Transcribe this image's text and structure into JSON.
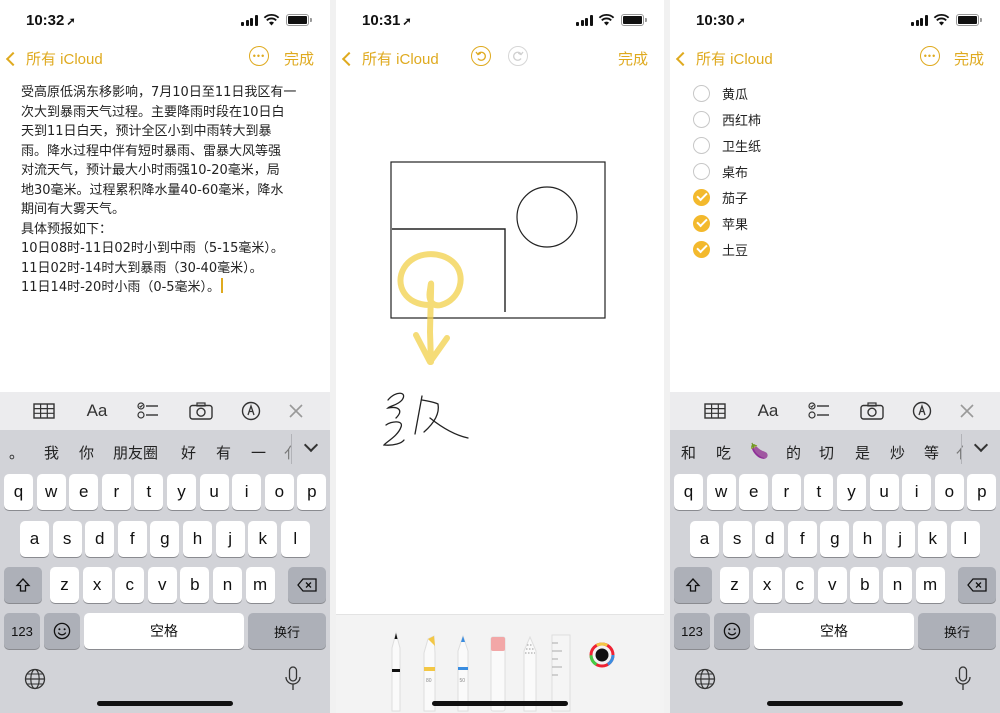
{
  "panels": [
    {
      "time": "10:32",
      "back_label": "所有 iCloud",
      "done_label": "完成",
      "note_lines": [
        "受高原低涡东移影响，7月10日至11日我区有一",
        "次大到暴雨天气过程。主要降雨时段在10日白",
        "天到11日白天，预计全区小到中雨转大到暴",
        "雨。降水过程中伴有短时暴雨、雷暴大风等强",
        "对流天气，预计最大小时雨强10-20毫米，局",
        "地30毫米。过程累积降水量40-60毫米，降水",
        "期间有大雾天气。",
        "具体预报如下：",
        "10日08时-11日02时小到中雨（5-15毫米）。",
        "11日02时-14时大到暴雨（30-40毫米）。",
        "11日14时-20时小雨（0-5毫米）。"
      ],
      "candidates": [
        "。",
        "我",
        "你",
        "朋友圈",
        "好",
        "有",
        "一",
        "亻"
      ]
    },
    {
      "time": "10:31",
      "back_label": "所有 iCloud",
      "done_label": "完成",
      "tool_labels": [
        "80",
        "50"
      ]
    },
    {
      "time": "10:30",
      "back_label": "所有 iCloud",
      "done_label": "完成",
      "checklist": [
        {
          "label": "黄瓜",
          "checked": false
        },
        {
          "label": "西红柿",
          "checked": false
        },
        {
          "label": "卫生纸",
          "checked": false
        },
        {
          "label": "桌布",
          "checked": false
        },
        {
          "label": "茄子",
          "checked": true
        },
        {
          "label": "苹果",
          "checked": true
        },
        {
          "label": "土豆",
          "checked": true
        }
      ],
      "candidates": [
        "和",
        "吃",
        "🍆",
        "的",
        "切",
        "是",
        "炒",
        "等",
        "亻"
      ]
    }
  ],
  "keyboard": {
    "row1": [
      "q",
      "w",
      "e",
      "r",
      "t",
      "y",
      "u",
      "i",
      "o",
      "p"
    ],
    "row2": [
      "a",
      "s",
      "d",
      "f",
      "g",
      "h",
      "j",
      "k",
      "l"
    ],
    "row3": [
      "z",
      "x",
      "c",
      "v",
      "b",
      "n",
      "m"
    ],
    "num_label": "123",
    "space_label": "空格",
    "return_label": "换行",
    "format_label": "Aa"
  },
  "colors": {
    "accent": "#dfaa1f",
    "check": "#f3b92d",
    "keyboard_bg": "#d2d3d8"
  }
}
